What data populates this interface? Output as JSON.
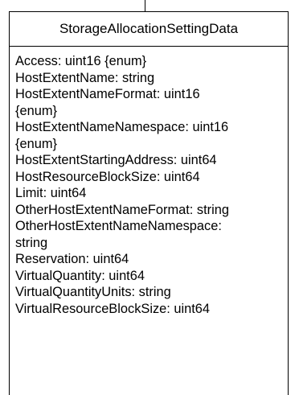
{
  "class": {
    "name": "StorageAllocationSettingData",
    "attribute_lines": [
      "Access: uint16 {enum}",
      "HostExtentName: string",
      "HostExtentNameFormat: uint16",
      "{enum}",
      "HostExtentNameNamespace: uint16",
      "{enum}",
      "HostExtentStartingAddress: uint64",
      "HostResourceBlockSize: uint64",
      "Limit: uint64",
      "OtherHostExtentNameFormat: string",
      "OtherHostExtentNameNamespace:",
      "string",
      "Reservation: uint64",
      "VirtualQuantity: uint64",
      "VirtualQuantityUnits: string",
      "VirtualResourceBlockSize: uint64"
    ]
  }
}
